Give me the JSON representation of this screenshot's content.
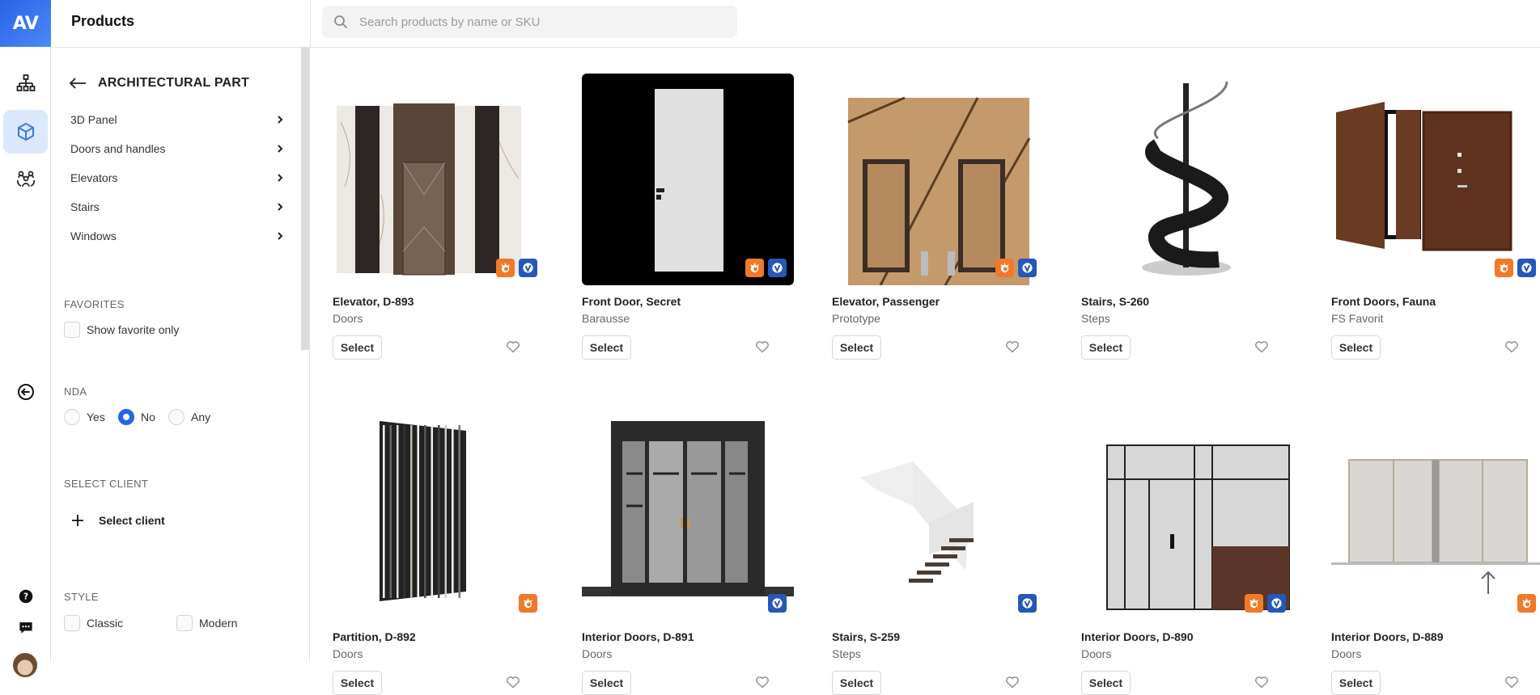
{
  "app": {
    "logo_text": "AV",
    "page_title": "Products"
  },
  "search": {
    "placeholder": "Search products by name or SKU",
    "value": ""
  },
  "rail": {
    "items": [
      {
        "name": "hierarchy",
        "icon": "sitemap-icon",
        "active": false
      },
      {
        "name": "products",
        "icon": "cube-icon",
        "active": true
      },
      {
        "name": "clients",
        "icon": "users-group-icon",
        "active": false
      },
      {
        "name": "collapse",
        "icon": "arrow-circle-left-icon",
        "active": false
      },
      {
        "name": "help",
        "icon": "help-circle-icon",
        "active": false
      },
      {
        "name": "chat",
        "icon": "chat-bubble-icon",
        "active": false
      },
      {
        "name": "profile",
        "icon": "avatar",
        "active": false
      }
    ],
    "accent": "#2a63e8"
  },
  "filters": {
    "category_title": "ARCHITECTURAL PART",
    "categories": [
      "3D Panel",
      "Doors and handles",
      "Elevators",
      "Stairs",
      "Windows"
    ],
    "favorites": {
      "label": "FAVORITES",
      "option": "Show favorite only",
      "checked": false
    },
    "nda": {
      "label": "NDA",
      "options": [
        "Yes",
        "No",
        "Any"
      ],
      "selected": "No"
    },
    "client": {
      "label": "SELECT CLIENT",
      "button": "Select client"
    },
    "style": {
      "label": "STYLE",
      "options": [
        {
          "label": "Classic",
          "checked": false
        },
        {
          "label": "Modern",
          "checked": false
        }
      ]
    }
  },
  "products": {
    "select_label": "Select",
    "items": [
      {
        "title": "Elevator, D-893",
        "subtitle": "Doors",
        "badges": [
          "corona",
          "vray"
        ]
      },
      {
        "title": "Front Door, Secret",
        "subtitle": "Barausse",
        "badges": [
          "corona",
          "vray"
        ]
      },
      {
        "title": "Elevator, Passenger",
        "subtitle": "Prototype",
        "badges": [
          "corona",
          "vray"
        ]
      },
      {
        "title": "Stairs, S-260",
        "subtitle": "Steps",
        "badges": []
      },
      {
        "title": "Front Doors, Fauna",
        "subtitle": "FS Favorit",
        "badges": [
          "corona",
          "vray"
        ]
      },
      {
        "title": "Partition, D-892",
        "subtitle": "Doors",
        "badges": [
          "corona"
        ]
      },
      {
        "title": "Interior Doors, D-891",
        "subtitle": "Doors",
        "badges": [
          "vray"
        ]
      },
      {
        "title": "Stairs, S-259",
        "subtitle": "Steps",
        "badges": [
          "vray"
        ]
      },
      {
        "title": "Interior Doors, D-890",
        "subtitle": "Doors",
        "badges": [
          "corona",
          "vray"
        ]
      },
      {
        "title": "Interior Doors, D-889",
        "subtitle": "Doors",
        "badges": [
          "corona"
        ]
      }
    ]
  },
  "colors": {
    "corona": "#f07a2a",
    "vray": "#2558b8",
    "accent": "#2a63e8"
  }
}
